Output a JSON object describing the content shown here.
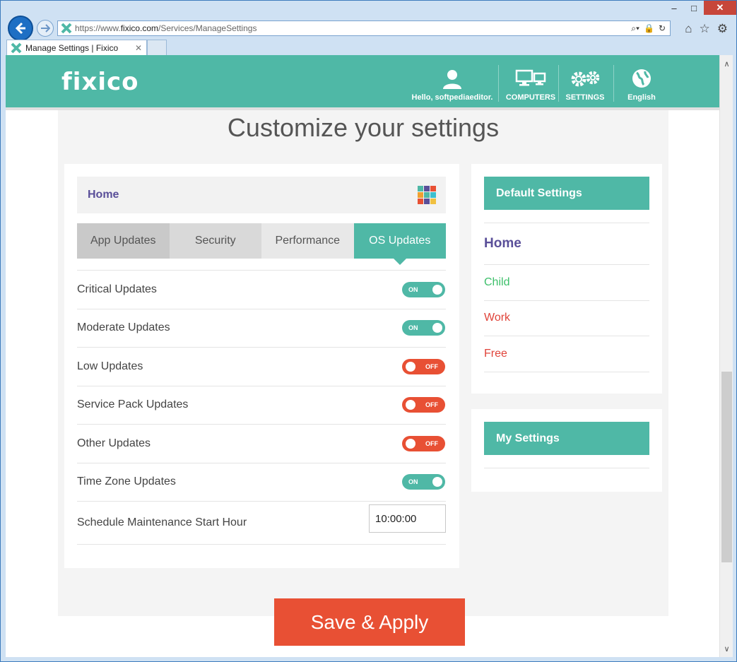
{
  "browser": {
    "url_prefix": "https://www.",
    "url_domain": "fixico.com",
    "url_path": "/Services/ManageSettings",
    "tab_title": "Manage Settings | Fixico",
    "minimize": "–",
    "maximize": "□",
    "close": "✕",
    "tab_close": "✕",
    "search_icon": "search-icon",
    "lock_icon": "lock-icon",
    "refresh_icon": "refresh-icon"
  },
  "header": {
    "logo": "fixico",
    "user_label": "Hello, softpediaeditor.",
    "computers_label": "COMPUTERS",
    "settings_label": "SETTINGS",
    "language_label": "English"
  },
  "page": {
    "title": "Customize your settings"
  },
  "profile": {
    "name": "Home",
    "grid_colors": [
      "#4fb8a6",
      "#5a4f99",
      "#e85034",
      "#f0a030",
      "#4fb8a6",
      "#5a4f99",
      "#e85034",
      "#5a4f99",
      "#f0c040"
    ]
  },
  "tabs": [
    {
      "label": "App Updates"
    },
    {
      "label": "Security"
    },
    {
      "label": "Performance"
    },
    {
      "label": "OS Updates"
    }
  ],
  "updates": [
    {
      "label": "Critical Updates",
      "state": "ON"
    },
    {
      "label": "Moderate Updates",
      "state": "ON"
    },
    {
      "label": "Low Updates",
      "state": "OFF"
    },
    {
      "label": "Service Pack Updates",
      "state": "OFF"
    },
    {
      "label": "Other Updates",
      "state": "OFF"
    },
    {
      "label": "Time Zone Updates",
      "state": "ON"
    }
  ],
  "maintenance": {
    "label": "Schedule Maintenance Start Hour",
    "value": "10:00:00"
  },
  "default_settings": {
    "header": "Default Settings",
    "items": [
      {
        "label": "Home",
        "color": "#5a4f99"
      },
      {
        "label": "Child",
        "color": "#3cbf6a"
      },
      {
        "label": "Work",
        "color": "#e0443a"
      },
      {
        "label": "Free",
        "color": "#e0443a"
      }
    ]
  },
  "my_settings": {
    "header": "My Settings"
  },
  "save_button": "Save & Apply",
  "colors": {
    "accent": "#4fb8a6",
    "danger": "#e85034",
    "brand_purple": "#5a4f99"
  }
}
